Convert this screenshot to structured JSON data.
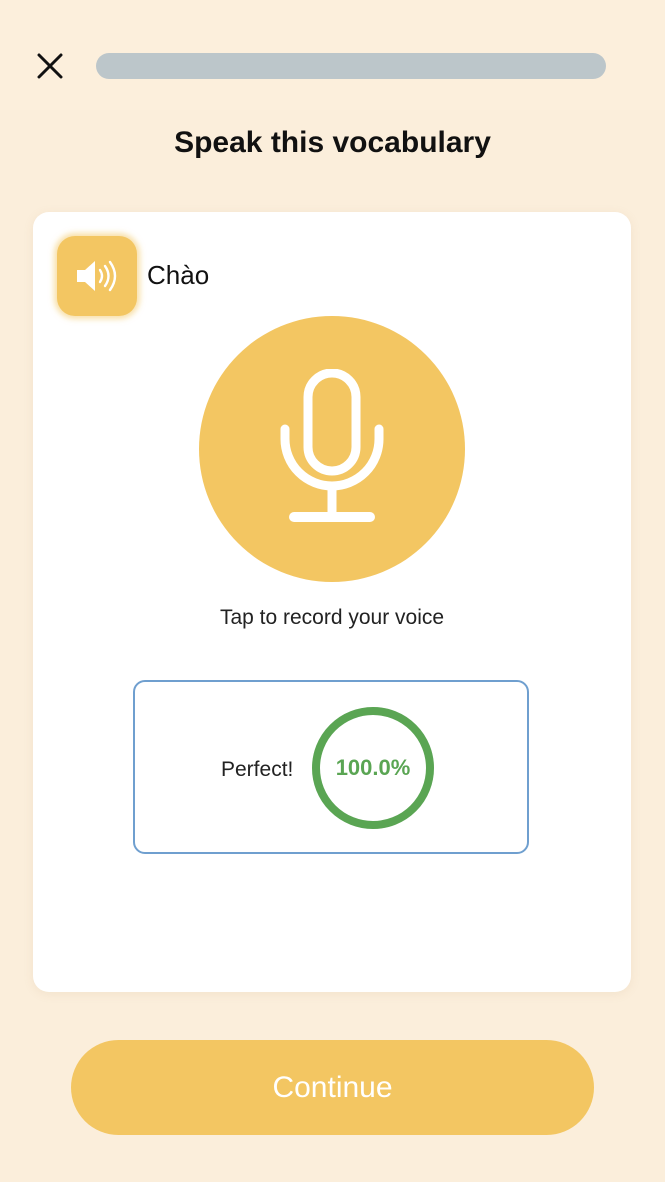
{
  "header": {
    "close_icon": "close-icon",
    "progress": 0.0
  },
  "title": "Speak this vocabulary",
  "card": {
    "audio_icon": "speaker-icon",
    "word": "Chào",
    "mic_icon": "microphone-icon",
    "hint": "Tap to record your voice",
    "result": {
      "label": "Perfect!",
      "score_text": "100.0%",
      "score": 100.0
    }
  },
  "continue_label": "Continue",
  "colors": {
    "background": "#fbeedb",
    "accent": "#f3c662",
    "progress_track": "#bcc6ca",
    "success": "#5aa553",
    "result_border": "#6f9fcf"
  }
}
